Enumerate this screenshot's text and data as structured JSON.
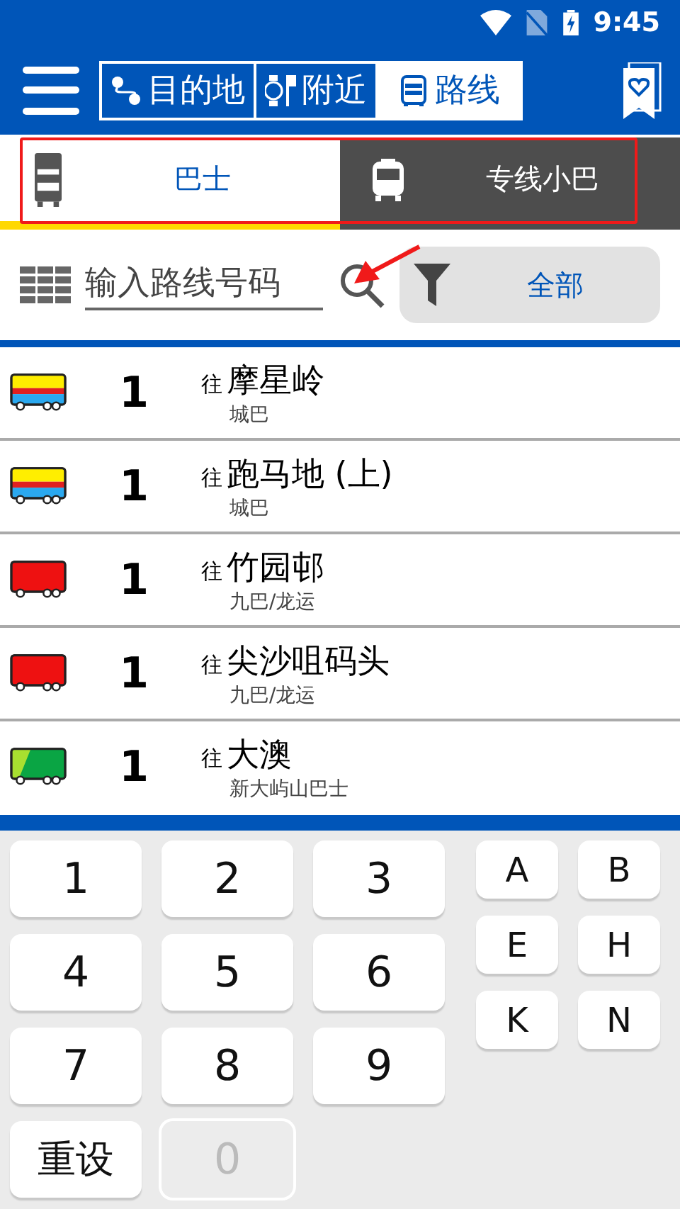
{
  "status_bar": {
    "time": "9:45"
  },
  "nav_tabs": [
    {
      "label": "目的地",
      "kind": "destination",
      "selected": false
    },
    {
      "label": "附近",
      "kind": "nearby",
      "selected": false
    },
    {
      "label": "路线",
      "kind": "route",
      "selected": true
    }
  ],
  "mode_tabs": [
    {
      "label": "巴士",
      "kind": "bus",
      "selected": true
    },
    {
      "label": "专线小巴",
      "kind": "minibus",
      "selected": false
    }
  ],
  "search": {
    "placeholder": "输入路线号码"
  },
  "filter": {
    "label": "全部"
  },
  "routes": [
    {
      "kind": "citybus",
      "number": "1",
      "to": "往",
      "destination": "摩星岭",
      "operator": "城巴"
    },
    {
      "kind": "citybus",
      "number": "1",
      "to": "往",
      "destination": "跑马地 (上)",
      "operator": "城巴"
    },
    {
      "kind": "kmb",
      "number": "1",
      "to": "往",
      "destination": "竹园邨",
      "operator": "九巴/龙运"
    },
    {
      "kind": "kmb",
      "number": "1",
      "to": "往",
      "destination": "尖沙咀码头",
      "operator": "九巴/龙运"
    },
    {
      "kind": "nlb",
      "number": "1",
      "to": "往",
      "destination": "大澳",
      "operator": "新大屿山巴士"
    }
  ],
  "keypad": {
    "digits": [
      {
        "label": "1",
        "disabled": false
      },
      {
        "label": "2",
        "disabled": false
      },
      {
        "label": "3",
        "disabled": false
      },
      {
        "label": "4",
        "disabled": false
      },
      {
        "label": "5",
        "disabled": false
      },
      {
        "label": "6",
        "disabled": false
      },
      {
        "label": "7",
        "disabled": false
      },
      {
        "label": "8",
        "disabled": false
      },
      {
        "label": "9",
        "disabled": false
      },
      {
        "label": "重设",
        "disabled": false
      },
      {
        "label": "0",
        "disabled": true
      }
    ],
    "letters": [
      "A",
      "B",
      "E",
      "H",
      "K",
      "N"
    ]
  }
}
